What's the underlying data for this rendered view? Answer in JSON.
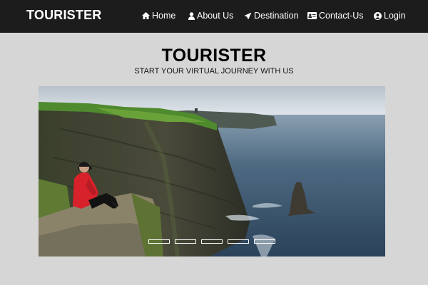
{
  "nav": {
    "brand": "TOURISTER",
    "items": [
      {
        "label": "Home",
        "icon": "home-icon"
      },
      {
        "label": "About Us",
        "icon": "user-icon"
      },
      {
        "label": "Destination",
        "icon": "plane-icon"
      },
      {
        "label": "Contact-Us",
        "icon": "contact-card-icon"
      },
      {
        "label": "Login",
        "icon": "user-circle-icon"
      }
    ]
  },
  "hero": {
    "title": "TOURISTER",
    "subtitle": "START YOUR VIRTUAL JOURNEY WITH US"
  },
  "carousel": {
    "slide_count": 5,
    "image": "cliffs-of-moher-photo"
  },
  "colors": {
    "navbar_bg": "#1c1c1c",
    "page_bg": "#d6d6d6",
    "nav_text": "#ffffff"
  }
}
